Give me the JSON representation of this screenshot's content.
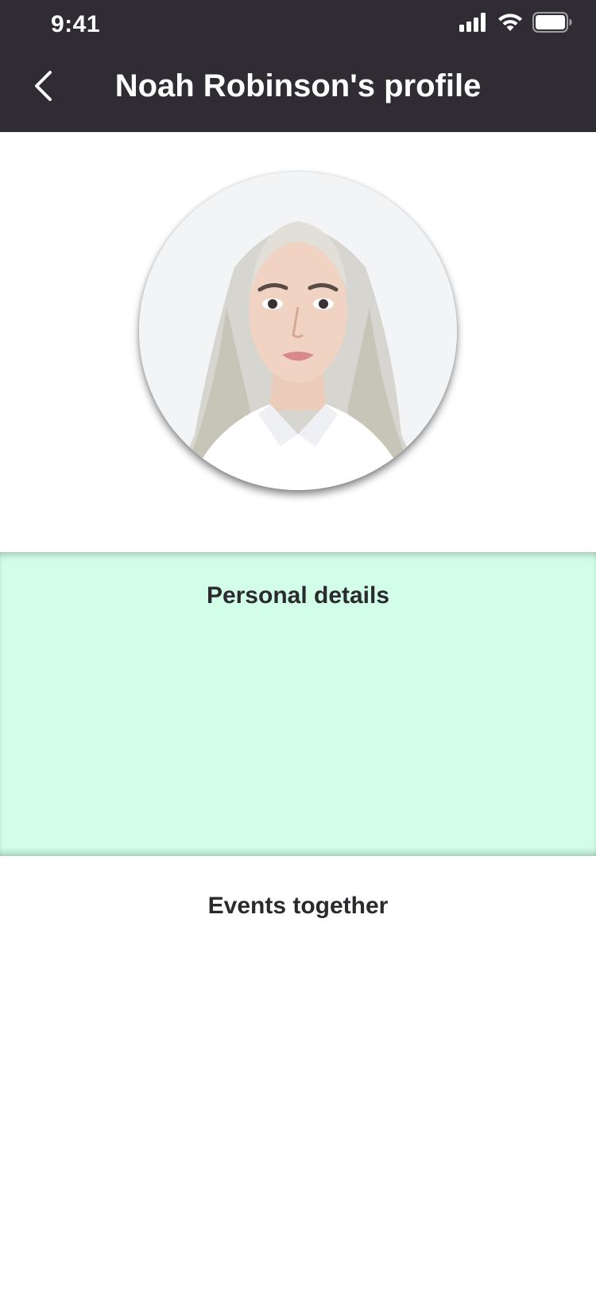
{
  "status_bar": {
    "time": "9:41",
    "icons": [
      "cellular-signal-icon",
      "wifi-icon",
      "battery-icon"
    ]
  },
  "header": {
    "title": "Noah Robinson's profile",
    "back_icon": "chevron-left-icon"
  },
  "profile": {
    "avatar_alt": "profile photo"
  },
  "sections": {
    "personal_details": {
      "title": "Personal details"
    },
    "events_together": {
      "title": "Events together"
    }
  },
  "colors": {
    "header_bg": "#2f2c34",
    "header_text": "#ffffff",
    "personal_bg": "#d1fde9",
    "section_title": "#2b2b2f",
    "page_bg": "#ffffff"
  }
}
